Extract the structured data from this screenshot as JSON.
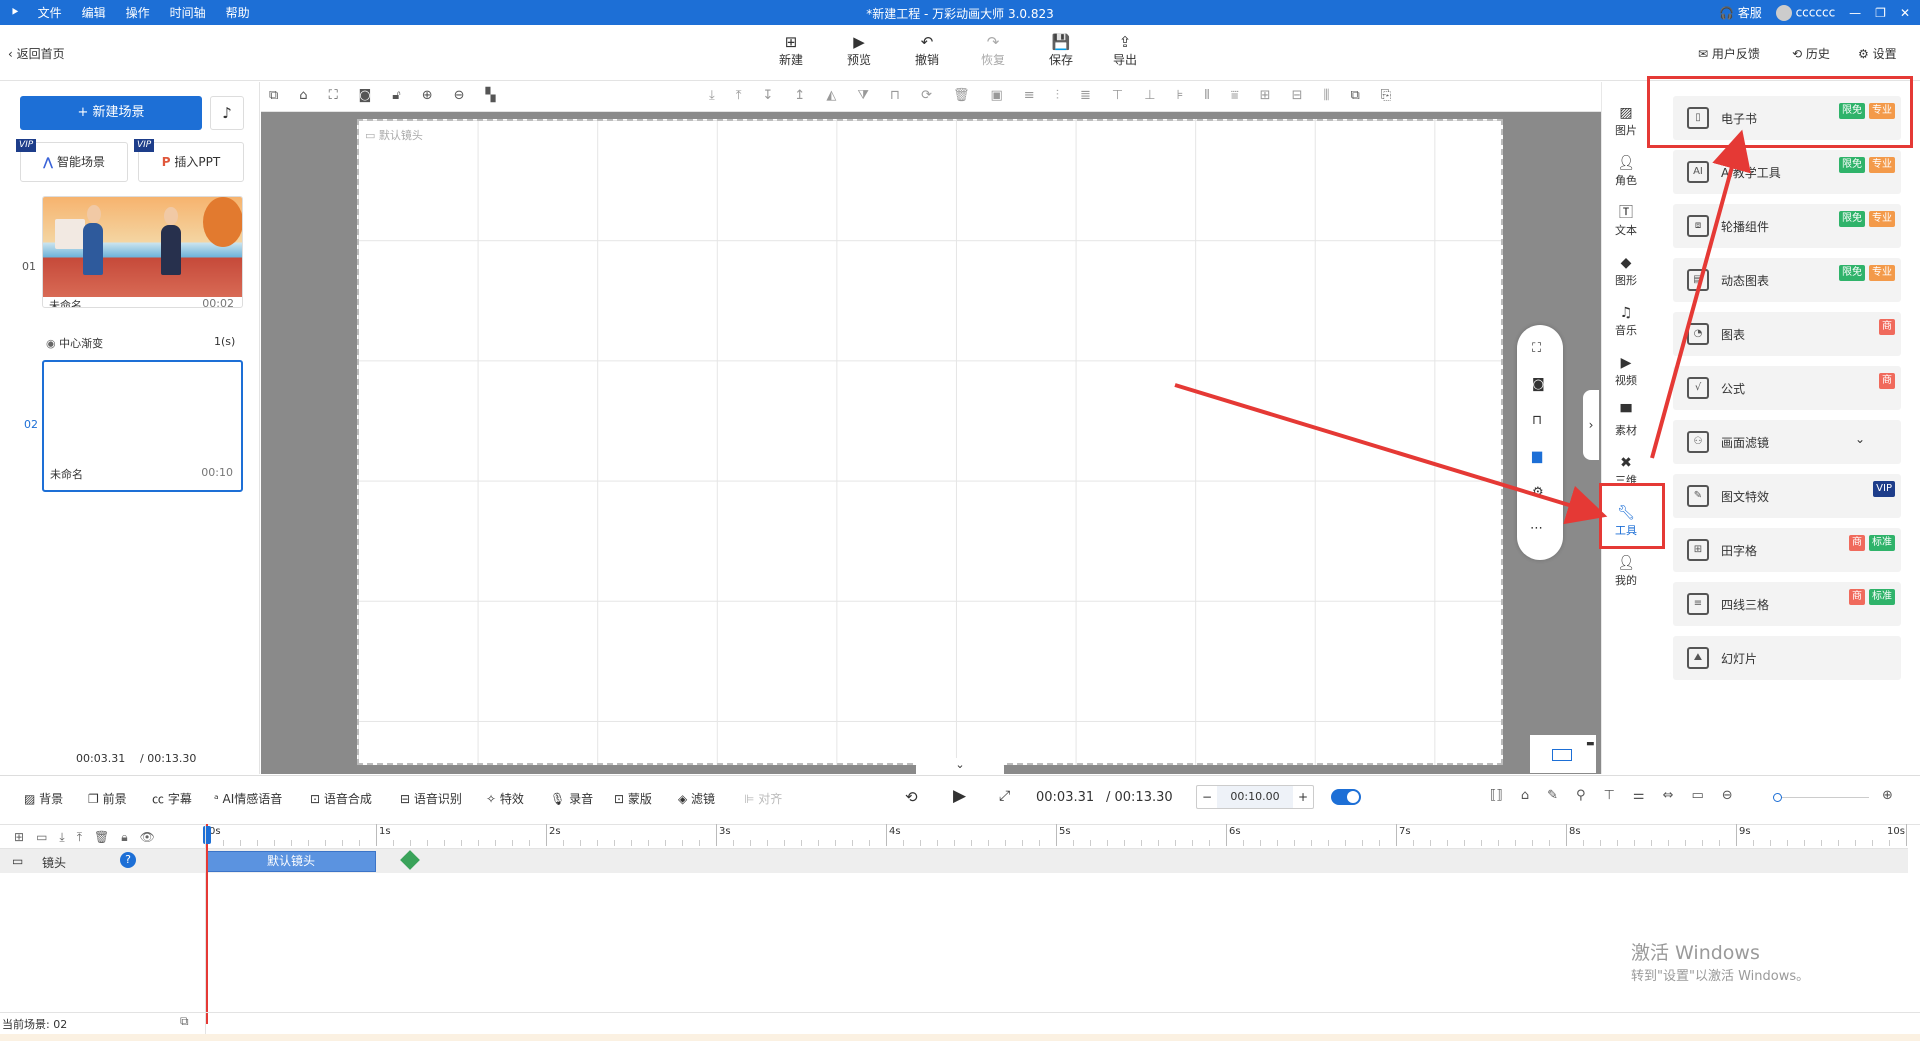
{
  "titlebar": {
    "menu": [
      "文件",
      "编辑",
      "操作",
      "时间轴",
      "帮助"
    ],
    "title": "*新建工程 - 万彩动画大师 3.0.823",
    "service": "客服",
    "username": "cccccc"
  },
  "toolbar": {
    "back": "返回首页",
    "buttons": [
      "新建",
      "预览",
      "撤销",
      "恢复",
      "保存",
      "导出"
    ],
    "feedback": "用户反馈",
    "history": "历史",
    "settings": "设置"
  },
  "left": {
    "new_scene": "新建场景",
    "smart_scene": "智能场景",
    "insert_ppt": "插入PPT",
    "vip": "VIP",
    "scenes": [
      {
        "index": "01",
        "name": "未命名",
        "duration": "00:02"
      },
      {
        "index": "02",
        "name": "未命名",
        "duration": "00:10"
      }
    ],
    "transition": {
      "name": "中心渐变",
      "duration": "1(s)"
    },
    "time_current": "00:03.31",
    "time_total": "/ 00:13.30"
  },
  "stage": {
    "camera_label": "默认镜头"
  },
  "rail": [
    {
      "label": "图片",
      "icon": "image-icon"
    },
    {
      "label": "角色",
      "icon": "person-icon"
    },
    {
      "label": "文本",
      "icon": "text-icon"
    },
    {
      "label": "图形",
      "icon": "shape-icon"
    },
    {
      "label": "音乐",
      "icon": "music-icon"
    },
    {
      "label": "视频",
      "icon": "video-icon"
    },
    {
      "label": "素材",
      "icon": "folder-icon"
    },
    {
      "label": "三维",
      "icon": "3d-icon"
    },
    {
      "label": "工具",
      "icon": "wrench-icon"
    },
    {
      "label": "我的",
      "icon": "user-icon"
    }
  ],
  "tools": [
    {
      "label": "电子书",
      "badges": [
        {
          "t": "限免",
          "c": "#2fb36a"
        },
        {
          "t": "专业",
          "c": "#f39a4a"
        }
      ]
    },
    {
      "label": "AI教学工具",
      "badges": [
        {
          "t": "限免",
          "c": "#2fb36a"
        },
        {
          "t": "专业",
          "c": "#f39a4a"
        }
      ]
    },
    {
      "label": "轮播组件",
      "badges": [
        {
          "t": "限免",
          "c": "#2fb36a"
        },
        {
          "t": "专业",
          "c": "#f39a4a"
        }
      ]
    },
    {
      "label": "动态图表",
      "badges": [
        {
          "t": "限免",
          "c": "#2fb36a"
        },
        {
          "t": "专业",
          "c": "#f39a4a"
        }
      ]
    },
    {
      "label": "图表",
      "badges": [
        {
          "t": "商",
          "c": "#f06a5c"
        }
      ]
    },
    {
      "label": "公式",
      "badges": [
        {
          "t": "商",
          "c": "#f06a5c"
        }
      ]
    },
    {
      "label": "画面滤镜",
      "badges": []
    },
    {
      "label": "图文特效",
      "badges": [
        {
          "t": "VIP",
          "c": "#1d3d8a"
        }
      ]
    },
    {
      "label": "田字格",
      "badges": [
        {
          "t": "商",
          "c": "#f06a5c"
        },
        {
          "t": "标准",
          "c": "#2fb36a"
        }
      ]
    },
    {
      "label": "四线三格",
      "badges": [
        {
          "t": "商",
          "c": "#f06a5c"
        },
        {
          "t": "标准",
          "c": "#2fb36a"
        }
      ]
    },
    {
      "label": "幻灯片",
      "badges": []
    }
  ],
  "bottom": {
    "tools": [
      "背景",
      "前景",
      "字幕",
      "AI情感语音",
      "语音合成",
      "语音识别",
      "特效",
      "录音",
      "蒙版",
      "滤镜",
      "对齐"
    ],
    "time_current": "00:03.31",
    "time_total": "/ 00:13.30",
    "duration_field": "00:10.00",
    "ruler": [
      "0s",
      "1s",
      "2s",
      "3s",
      "4s",
      "5s",
      "6s",
      "7s",
      "8s",
      "9s",
      "10s"
    ],
    "track_label": "镜头",
    "clip_label": "默认镜头",
    "status": "当前场景: 02"
  },
  "watermark": {
    "line1": "激活 Windows",
    "line2": "转到\"设置\"以激活 Windows。"
  }
}
